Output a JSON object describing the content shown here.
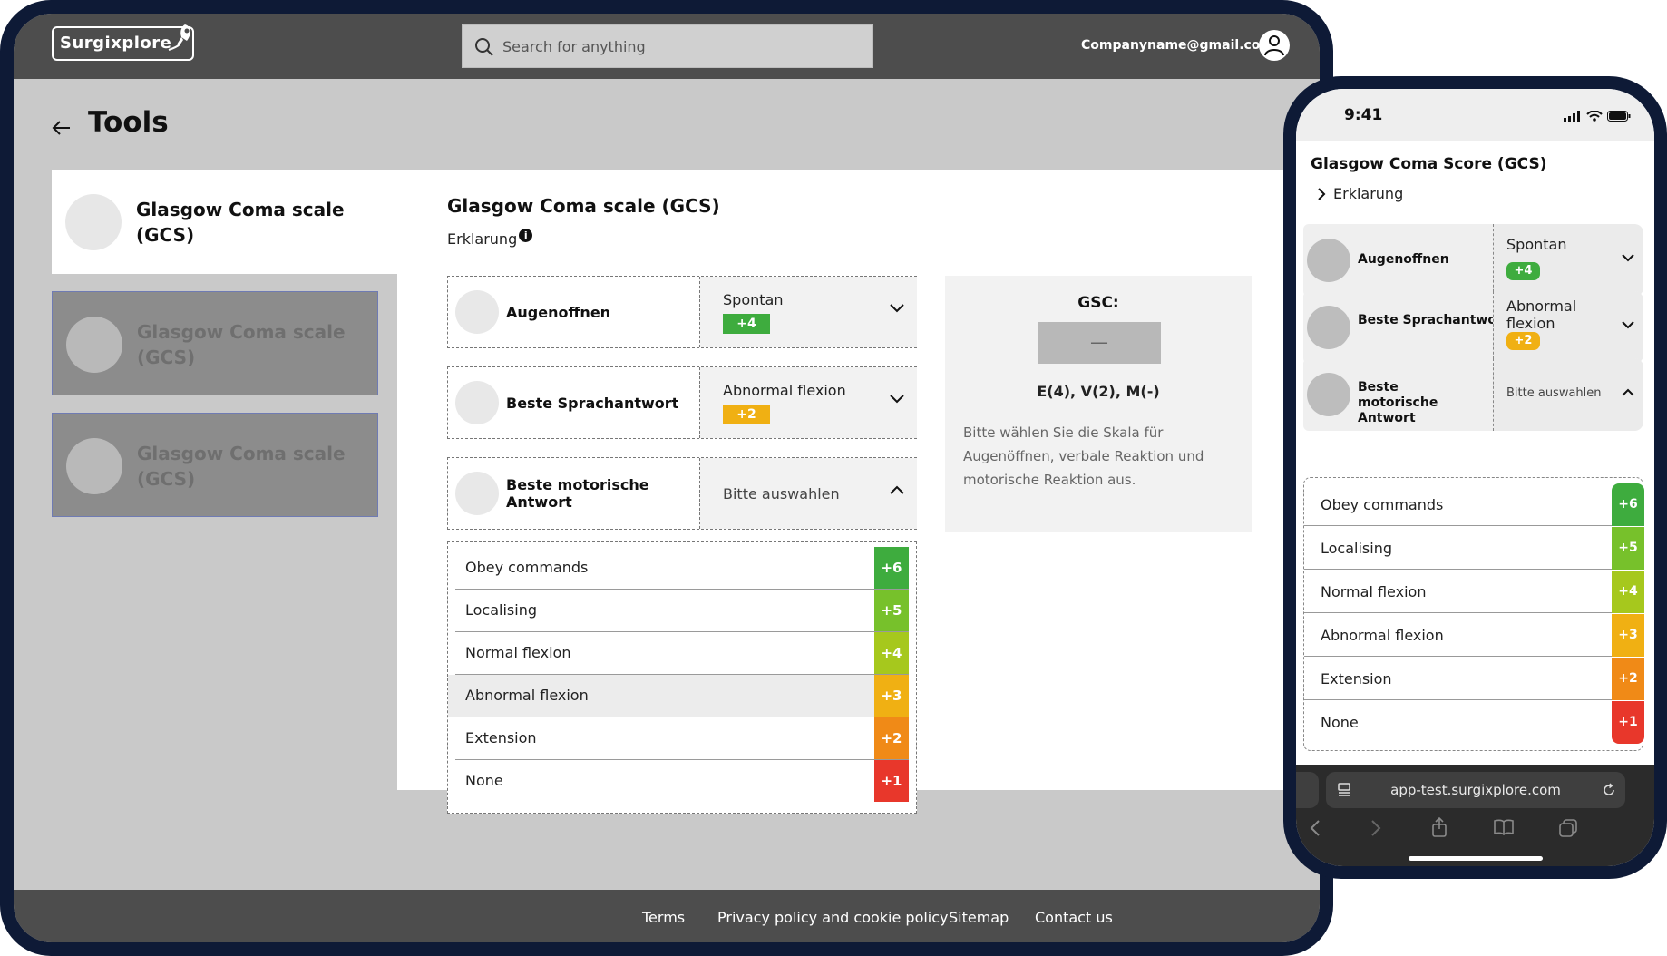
{
  "colors": {
    "frame": "#0e1a36",
    "topbar": "#4d4d4d",
    "score6": "#3eac3e",
    "score5": "#77c12b",
    "score4": "#a6c81d",
    "score3": "#f0b013",
    "score2": "#f08a17",
    "score1": "#e8372b"
  },
  "desktop": {
    "logo": "Surgixplore",
    "search_placeholder": "Search for anything",
    "email": "Companyname@gmail.com",
    "page_title": "Tools",
    "sidebar": [
      "Glasgow Coma scale (GCS)",
      "Glasgow Coma scale (GCS)",
      "Glasgow Coma scale (GCS)"
    ],
    "main_title": "Glasgow Coma scale (GCS)",
    "erklarung": "Erklarung",
    "questions": [
      {
        "label": "Augenoffnen",
        "value": "Spontan",
        "badge": "+4"
      },
      {
        "label": "Beste Sprachantwort",
        "value": "Abnormal flexion",
        "badge": "+2"
      },
      {
        "label": "Beste motorische Antwort",
        "placeholder": "Bitte auswahlen"
      }
    ],
    "options": [
      {
        "label": "Obey commands",
        "score": "+6"
      },
      {
        "label": "Localising",
        "score": "+5"
      },
      {
        "label": "Normal flexion",
        "score": "+4"
      },
      {
        "label": "Abnormal flexion",
        "score": "+3"
      },
      {
        "label": "Extension",
        "score": "+2"
      },
      {
        "label": "None",
        "score": "+1"
      }
    ],
    "gsc": {
      "title": "GSC:",
      "value": "—",
      "formula": "E(4), V(2), M(-)",
      "description": "Bitte wählen Sie die Skala für Augenöffnen, verbale Reaktion und motorische Reaktion aus."
    },
    "footer": [
      "Terms",
      "Privacy policy and cookie policy",
      "Sitemap",
      "Contact us"
    ]
  },
  "phone": {
    "time": "9:41",
    "title": "Glasgow Coma Score (GCS)",
    "erklarung": "Erklarung",
    "questions": [
      {
        "label": "Augenoffnen",
        "value": "Spontan",
        "badge": "+4"
      },
      {
        "label": "Beste Sprachantwort",
        "value": "Abnormal flexion",
        "badge": "+2"
      },
      {
        "label": "Beste motorische Antwort",
        "placeholder": "Bitte auswahlen"
      }
    ],
    "options": [
      {
        "label": "Obey commands",
        "score": "+6"
      },
      {
        "label": "Localising",
        "score": "+5"
      },
      {
        "label": "Normal flexion",
        "score": "+4"
      },
      {
        "label": "Abnormal flexion",
        "score": "+3"
      },
      {
        "label": "Extension",
        "score": "+2"
      },
      {
        "label": "None",
        "score": "+1"
      }
    ],
    "url": "app-test.surgixplore.com"
  }
}
